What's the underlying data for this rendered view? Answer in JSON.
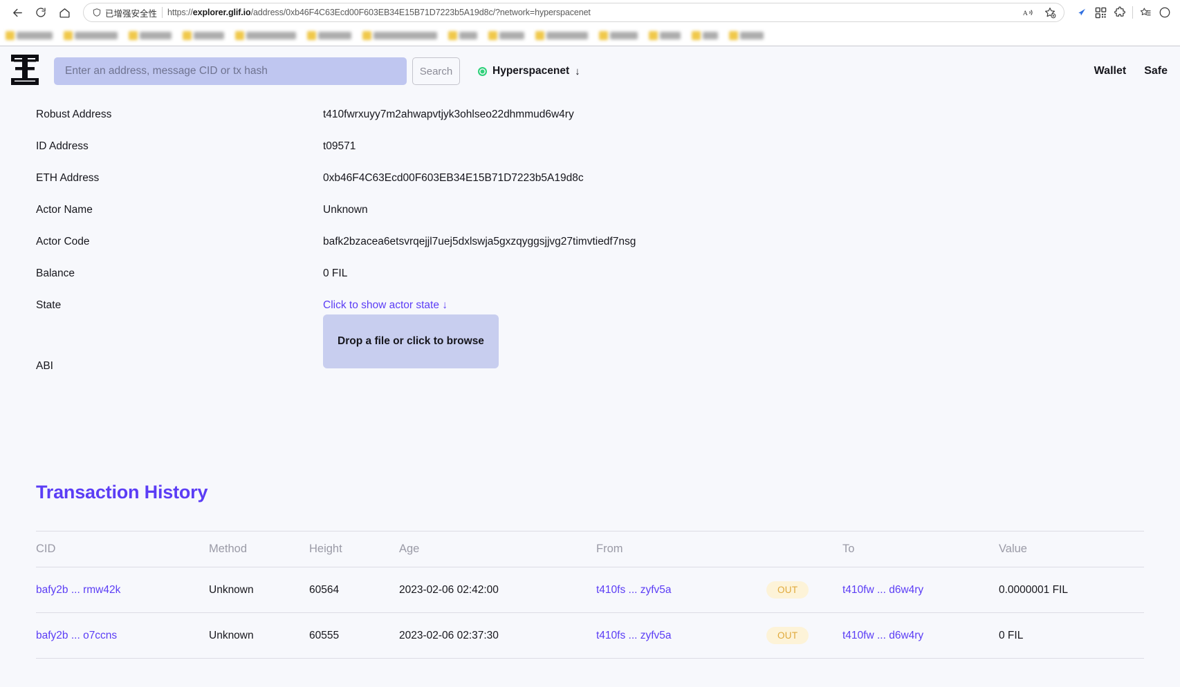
{
  "browser": {
    "back_icon": "back-arrow-icon",
    "reload_icon": "reload-icon",
    "home_icon": "home-icon",
    "security_label": "已增强安全性",
    "url_prefix": "https://",
    "url_domain": "explorer.glif.io",
    "url_path": "/address/0xb46F4C63Ecd00F603EB34E15B71D7223b5A19d8c/?network=hyperspacenet",
    "read_aloud_icon": "read-aloud-icon",
    "add_favorite_icon": "add-favorite-star-icon",
    "extension_icon": "extension-blue-arrow-icon",
    "qr_icon": "qr-code-icon",
    "puzzle_icon": "extensions-puzzle-icon",
    "collections_icon": "collections-icon",
    "settings_icon": "settings-icon"
  },
  "header": {
    "logo_name": "glif-logo",
    "search_placeholder": "Enter an address, message CID or tx hash",
    "search_value": "",
    "search_button": "Search",
    "network": "Hyperspacenet",
    "network_arrow": "↓",
    "nav": [
      "Wallet",
      "Safe"
    ]
  },
  "details": [
    {
      "label": "Robust Address",
      "value": "t410fwrxuyy7m2ahwapvtjyk3ohlseo22dhmmud6w4ry",
      "link": false
    },
    {
      "label": "ID Address",
      "value": "t09571",
      "link": false
    },
    {
      "label": "ETH Address",
      "value": "0xb46F4C63Ecd00F603EB34E15B71D7223b5A19d8c",
      "link": false
    },
    {
      "label": "Actor Name",
      "value": "Unknown",
      "link": false
    },
    {
      "label": "Actor Code",
      "value": "bafk2bzacea6etsvrqejjl7uej5dxlswja5gxzqyggsjjvg27timvtiedf7nsg",
      "link": false
    },
    {
      "label": "Balance",
      "value": "0 FIL",
      "link": false
    },
    {
      "label": "State",
      "value": "Click to show actor state ↓",
      "link": true
    }
  ],
  "abi": {
    "label": "ABI",
    "dropzone_text": "Drop a file or click to browse"
  },
  "transactions": {
    "title": "Transaction History",
    "columns": [
      "CID",
      "Method",
      "Height",
      "Age",
      "From",
      "",
      "To",
      "Value"
    ],
    "rows": [
      {
        "cid": "bafy2b ... rmw42k",
        "method": "Unknown",
        "height": "60564",
        "age": "2023-02-06 02:42:00",
        "from": "t410fs ... zyfv5a",
        "direction": "OUT",
        "to": "t410fw ... d6w4ry",
        "value": "0.0000001 FIL"
      },
      {
        "cid": "bafy2b ... o7ccns",
        "method": "Unknown",
        "height": "60555",
        "age": "2023-02-06 02:37:30",
        "from": "t410fs ... zyfv5a",
        "direction": "OUT",
        "to": "t410fw ... d6w4ry",
        "value": "0 FIL"
      }
    ]
  },
  "colors": {
    "accent_purple": "#5b3df5",
    "search_field": "#bfc6f0",
    "dropzone": "#c8ceef",
    "badge_bg": "#fdf3d8",
    "badge_text": "#e0a93b",
    "page_bg": "#f7f8fc",
    "network_dot": "#2fd17a"
  }
}
